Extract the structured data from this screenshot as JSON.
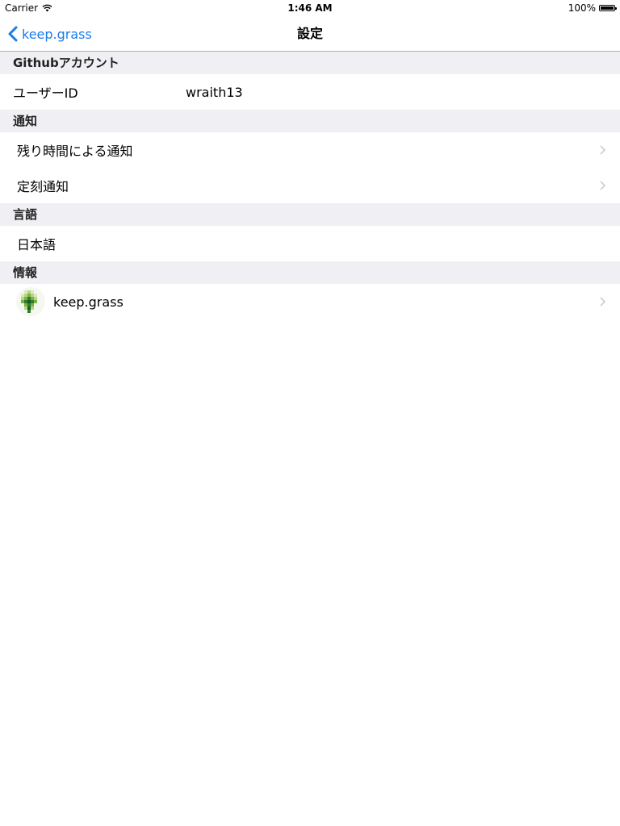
{
  "status_bar": {
    "carrier": "Carrier",
    "time": "1:46 AM",
    "battery": "100%",
    "battery_level": 1.0
  },
  "nav": {
    "back_label": "keep.grass",
    "title": "設定"
  },
  "sections": {
    "account": {
      "header": "Githubアカウント",
      "user_id_label": "ユーザーID",
      "user_id_value": "wraith13"
    },
    "notification": {
      "header": "通知",
      "items": [
        {
          "label": "残り時間による通知"
        },
        {
          "label": "定刻通知"
        }
      ]
    },
    "language": {
      "header": "言語",
      "value": "日本語"
    },
    "info": {
      "header": "情報",
      "app_name": "keep.grass"
    }
  },
  "colors": {
    "accent": "#1a7be9",
    "section_background": "#efeff4",
    "separator": "#b2b2b2",
    "chevron": "#c7c7cc"
  },
  "icons": [
    "wifi-icon",
    "battery-icon",
    "back-chevron-icon",
    "disclosure-chevron-icon",
    "keep-grass-app-icon"
  ]
}
